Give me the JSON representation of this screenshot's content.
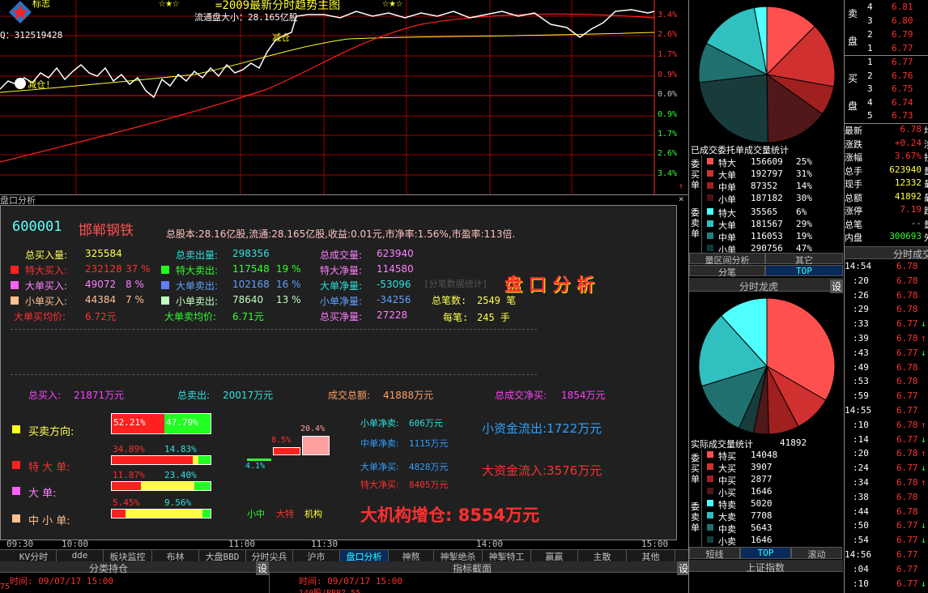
{
  "chart_top": {
    "title": "=2009最新分时趋势主图",
    "stars_left": "☆★☆",
    "stars_right": "☆★☆",
    "float_cap": "流通盘大小：28.165亿股",
    "q_label": "Q：312519428",
    "logo_text": "标志",
    "mark_jian": "减仓",
    "mark_jian2": "减仓!",
    "pct_labels": [
      "3.4%",
      "2.6%",
      "1.7%",
      "0.9%",
      "0.0%",
      "0.9%",
      "1.7%",
      "2.6%",
      "3.4%"
    ],
    "pct_colors": [
      "#ff3030",
      "#ff3030",
      "#ff3030",
      "#ff3030",
      "#c0c0c0",
      "#30ff30",
      "#30ff30",
      "#30ff30",
      "#30ff30"
    ]
  },
  "panel": {
    "header": "盘口分析",
    "code": "600001",
    "name": "邯郸钢铁",
    "summary": "总股本:28.16亿股,流通:28.165亿股,收益:0.01元,市净率:1.56%,市盈率:113倍.",
    "title_big": "盘 口 分 析",
    "watermark": "[分笔数据统计]",
    "rows": [
      [
        "总买入量:",
        "325584",
        "",
        "总卖出量:",
        "298356",
        "",
        "总成交量:",
        "623940"
      ],
      [
        "特大买入:",
        "232128",
        "37 %",
        "特大卖出:",
        "117548",
        "19 %",
        "特大净量:",
        "114580"
      ],
      [
        "大单买入:",
        "49072",
        "8 %",
        "大单卖出:",
        "102168",
        "16 %",
        "大单净量:",
        "-53096"
      ],
      [
        "小单买入:",
        "44384",
        "7 %",
        "小单卖出:",
        "78640",
        "13 %",
        "小单净量:",
        "-34256"
      ],
      [
        "大单买均价:",
        "6.72元",
        "",
        "大单卖均价:",
        "6.71元",
        "",
        "总买净量:",
        "27228"
      ]
    ],
    "total_trades_label": "总笔数:",
    "total_trades": "2549 笔",
    "per_trade_label": "每笔:",
    "per_trade": "245 手",
    "amounts": [
      {
        "label": "总买入:",
        "value": "21871万元"
      },
      {
        "label": "总卖出:",
        "value": "20017万元"
      },
      {
        "label": "成交总额:",
        "value": "41888万元"
      },
      {
        "label": "总成交净买:",
        "value": "1854万元"
      }
    ],
    "bars": [
      {
        "label": "买卖方向:",
        "left": "52.21%",
        "right": "47.79%",
        "left_frac": 0.5221
      },
      {
        "label": "特 大 单:",
        "left": "34.89%",
        "right": "14.83%",
        "buy": 0.3489,
        "sell": 0.1483
      },
      {
        "label": "大   单:",
        "left": "11.87%",
        "right": "23.40%",
        "buy": 0.1187,
        "sell": 0.234
      },
      {
        "label": "中 小 单:",
        "left": "5.45%",
        "right": "9.56%",
        "buy": 0.0545,
        "sell": 0.0956
      }
    ],
    "mini_bars": {
      "a": "4.1%",
      "b": "8.5%",
      "c": "20.4%",
      "labels": [
        "小中",
        "大特",
        "机构"
      ]
    },
    "nets": [
      {
        "label": "小单净卖:",
        "value": "606万元"
      },
      {
        "label": "中单净卖:",
        "value": "1115万元"
      },
      {
        "label": "大单净买:",
        "value": "4828万元"
      },
      {
        "label": "特大净买:",
        "value": "8405万元"
      }
    ],
    "flow_out": "小资金流出:1722万元",
    "flow_in": "大资金流入:3576万元",
    "big_msg": "大机构增仓: 8554万元"
  },
  "time_axis": [
    "09:30",
    "10:00",
    "11:00",
    "11:30",
    "14:00",
    "15:00"
  ],
  "tabs": [
    "KV分时",
    "dde",
    "板块监控",
    "布林",
    "大盘BBD",
    "分时尖兵",
    "沪市",
    "盘口分析",
    "神熬",
    "神掣绝杀",
    "神掣特工",
    "赢赢",
    "主散",
    "其他"
  ],
  "bottom": {
    "left_title": "分类持仓",
    "mid_title": "指标截面",
    "right_title": "上证指数",
    "set": "设",
    "time_line": "时间: 09/07/17 15:00",
    "partial": "149股/BBB7.55"
  },
  "pie_top": {
    "title": "已成交委托单成交量统计",
    "buy_side": "委买单",
    "sell_side": "委卖单",
    "buy": [
      {
        "n": "特大",
        "v": "156609",
        "p": "25%",
        "c": "#ff5050"
      },
      {
        "n": "大单",
        "v": "192797",
        "p": "31%",
        "c": "#d03030"
      },
      {
        "n": "中单",
        "v": "87352",
        "p": "14%",
        "c": "#a02020"
      },
      {
        "n": "小单",
        "v": "187182",
        "p": "30%",
        "c": "#501010"
      }
    ],
    "sell": [
      {
        "n": "特大",
        "v": "35565",
        "p": "6%",
        "c": "#50ffff"
      },
      {
        "n": "大单",
        "v": "181567",
        "p": "29%",
        "c": "#30c0c0"
      },
      {
        "n": "中单",
        "v": "116053",
        "p": "19%",
        "c": "#208080"
      },
      {
        "n": "小单",
        "v": "290756",
        "p": "47%",
        "c": "#103838"
      }
    ],
    "slices": [
      0.25,
      0.31,
      0.14,
      0.3,
      0.47,
      0.19,
      0.29,
      0.06
    ],
    "tabs": [
      "量区间分析",
      "其它",
      "分笔",
      "TOP"
    ]
  },
  "pie_bot": {
    "title": "分时龙虎",
    "set": "设",
    "subtitle": "实际成交量统计",
    "total": "41892",
    "buy": [
      {
        "n": "特买",
        "v": "14048"
      },
      {
        "n": "大买",
        "v": "3907"
      },
      {
        "n": "中买",
        "v": "2877"
      },
      {
        "n": "小买",
        "v": "1646"
      }
    ],
    "sell": [
      {
        "n": "特卖",
        "v": "5020"
      },
      {
        "n": "大卖",
        "v": "7708"
      },
      {
        "n": "中卖",
        "v": "5643"
      },
      {
        "n": "小卖",
        "v": "1646"
      }
    ],
    "slices": [
      0.37,
      0.1,
      0.08,
      0.04,
      0.04,
      0.15,
      0.2,
      0.13
    ],
    "tabs": [
      "短线",
      "TOP",
      "滚动"
    ]
  },
  "orderbook": {
    "sell": [
      [
        "4",
        "6.81"
      ],
      [
        "3",
        "6.80"
      ],
      [
        "2",
        "6.79"
      ],
      [
        "1",
        "6.77"
      ]
    ],
    "buy": [
      [
        "1",
        "6.77"
      ],
      [
        "2",
        "6.76"
      ],
      [
        "3",
        "6.75"
      ],
      [
        "4",
        "6.74"
      ],
      [
        "5",
        "6.73"
      ]
    ],
    "sell_label": [
      "卖",
      "盘"
    ],
    "buy_label": [
      "买",
      "盘"
    ],
    "stats": [
      [
        "最新",
        "6.78"
      ],
      [
        "涨跌",
        "+0.24"
      ],
      [
        "涨幅",
        "3.67%"
      ],
      [
        "总手",
        "623940"
      ],
      [
        "现手",
        "12332"
      ],
      [
        "总额",
        "41892"
      ],
      [
        "涨停",
        "7.19"
      ],
      [
        "总笔",
        "--"
      ],
      [
        "内盘",
        "300693"
      ]
    ],
    "stats_right": [
      "均",
      "涉",
      "抄",
      "量",
      "最",
      "最",
      "跌",
      "量",
      "外"
    ],
    "trades_title": "分时成交",
    "trades": [
      [
        "14:54",
        "6.78",
        ""
      ],
      [
        ":20",
        "6.78",
        ""
      ],
      [
        ":26",
        "6.78",
        ""
      ],
      [
        ":29",
        "6.78",
        ""
      ],
      [
        ":33",
        "6.77",
        "d"
      ],
      [
        ":39",
        "6.78",
        "u"
      ],
      [
        ":43",
        "6.77",
        "d"
      ],
      [
        ":49",
        "6.78",
        ""
      ],
      [
        ":53",
        "6.78",
        ""
      ],
      [
        ":59",
        "6.77",
        ""
      ],
      [
        "14:55",
        "6.77",
        ""
      ],
      [
        ":10",
        "6.78",
        "u"
      ],
      [
        ":14",
        "6.77",
        "d"
      ],
      [
        ":20",
        "6.78",
        "u"
      ],
      [
        ":24",
        "6.77",
        "d"
      ],
      [
        ":34",
        "6.78",
        "u"
      ],
      [
        ":38",
        "6.78",
        ""
      ],
      [
        ":44",
        "6.78",
        ""
      ],
      [
        ":50",
        "6.77",
        "d"
      ],
      [
        ":54",
        "6.77",
        "d"
      ],
      [
        "14:56",
        "6.77",
        ""
      ],
      [
        ":04",
        "6.77",
        ""
      ],
      [
        ":10",
        "6.77",
        "d"
      ]
    ]
  }
}
